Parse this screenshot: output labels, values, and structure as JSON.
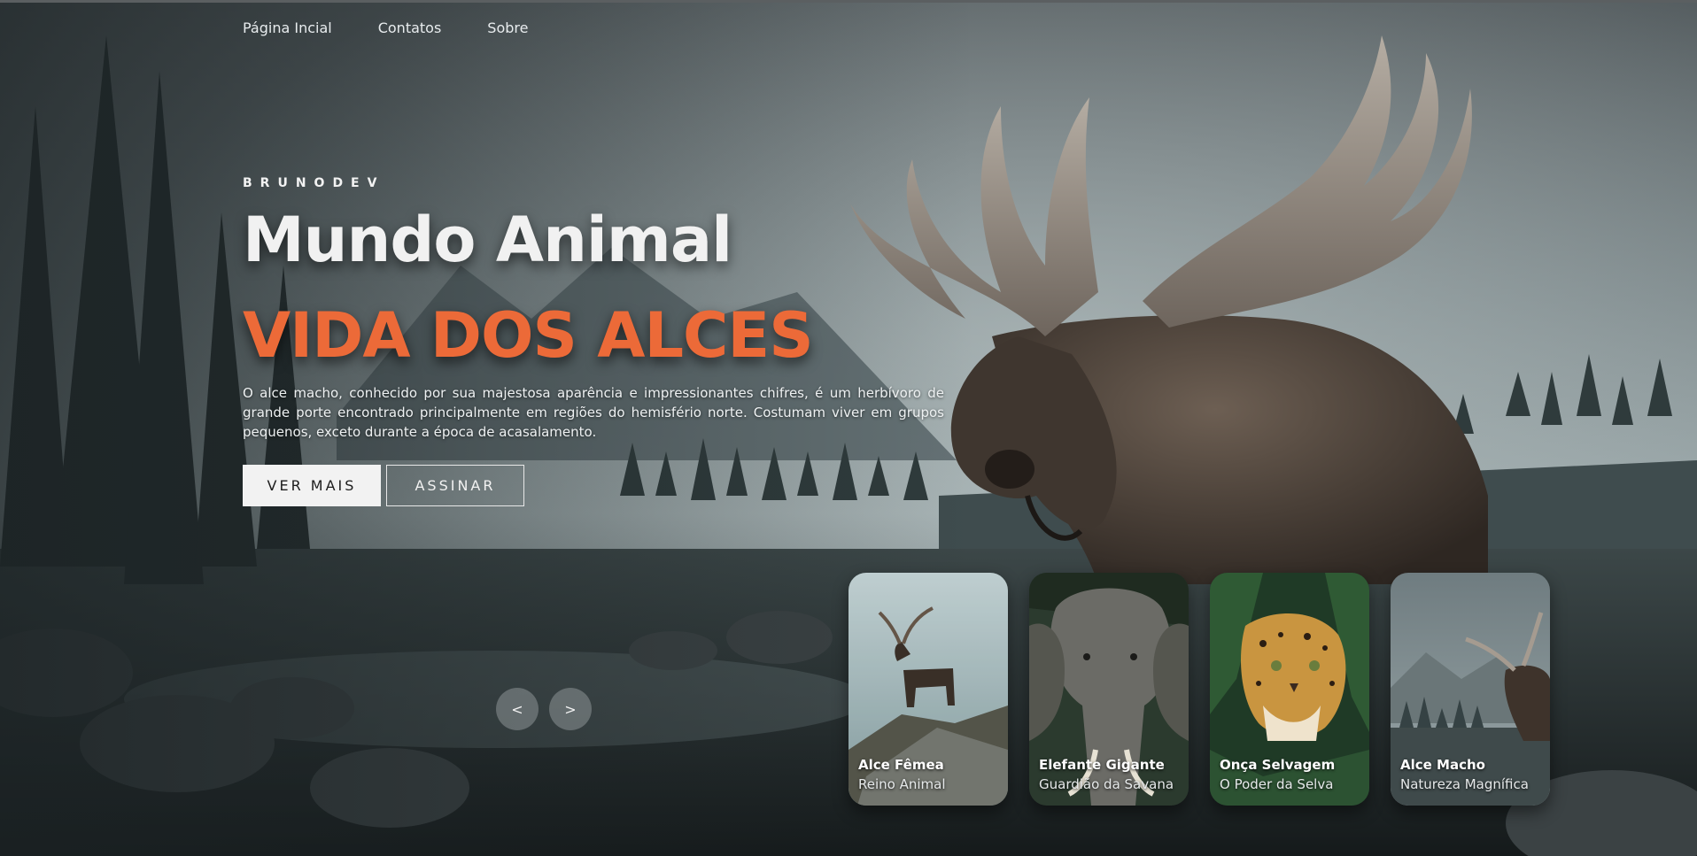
{
  "nav": {
    "items": [
      {
        "label": "Página Incial"
      },
      {
        "label": "Contatos"
      },
      {
        "label": "Sobre"
      }
    ]
  },
  "hero": {
    "brand": "BRUNODEV",
    "title": "Mundo Animal",
    "subtitle": "VIDA DOS ALCES",
    "description": "O alce macho, conhecido por sua majestosa aparência e impressionantes chifres, é um herbívoro de grande porte encontrado principalmente em regiões do hemisfério norte. Costumam viver em grupos pequenos, exceto durante a época de acasalamento.",
    "buttons": {
      "primary": "VER MAIS",
      "secondary": "ASSINAR"
    }
  },
  "slider": {
    "prev": "<",
    "next": ">"
  },
  "cards": [
    {
      "title": "Alce Fêmea",
      "subtitle": "Reino Animal"
    },
    {
      "title": "Elefante Gigante",
      "subtitle": "Guardião da Savana"
    },
    {
      "title": "Onça Selvagem",
      "subtitle": "O Poder da Selva"
    },
    {
      "title": "Alce Macho",
      "subtitle": "Natureza Magnífica"
    }
  ],
  "colors": {
    "accent": "#ec6a38",
    "text": "#f1f1f1"
  }
}
